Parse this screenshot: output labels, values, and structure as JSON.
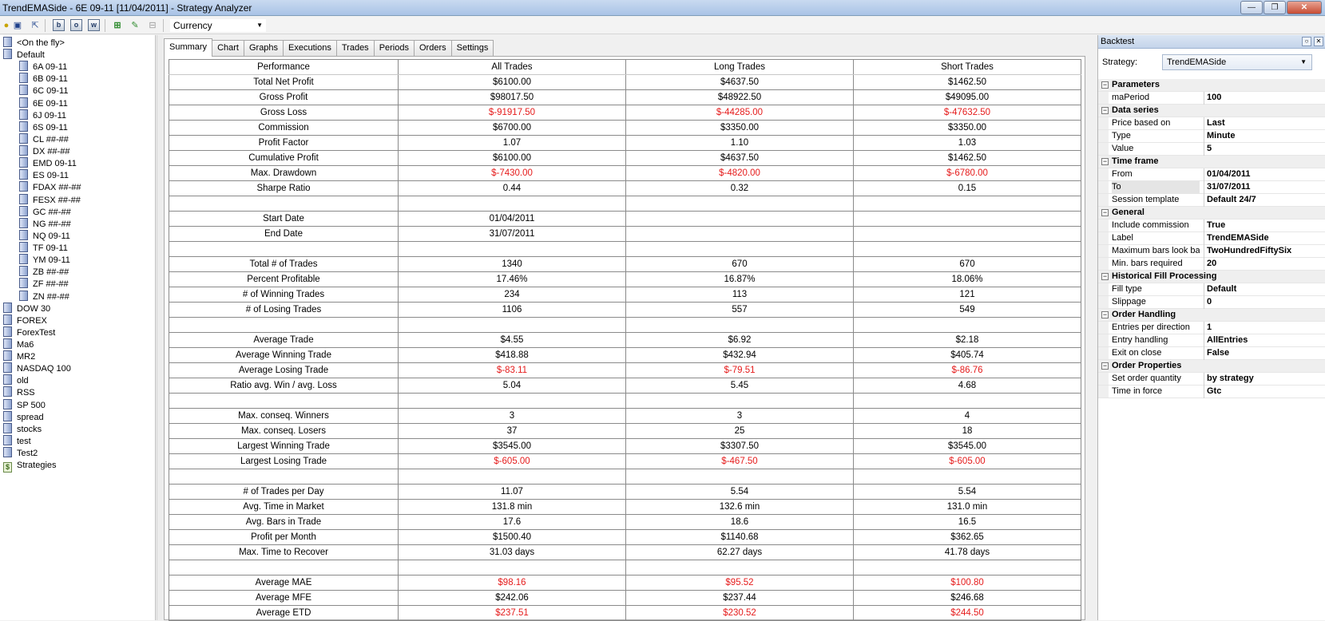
{
  "window": {
    "title": "TrendEMASide - 6E 09-11 [11/04/2011] - Strategy Analyzer"
  },
  "toolbar": {
    "btn_b": "b",
    "btn_o": "o",
    "btn_w": "w",
    "currency_selected": "Currency"
  },
  "tree": [
    {
      "label": "<On the fly>",
      "level": 0,
      "icon": "instrument-list-icon"
    },
    {
      "label": "Default",
      "level": 0,
      "icon": "instrument-list-icon"
    },
    {
      "label": "6A 09-11",
      "level": 1,
      "icon": "instrument-icon"
    },
    {
      "label": "6B 09-11",
      "level": 1,
      "icon": "instrument-icon"
    },
    {
      "label": "6C 09-11",
      "level": 1,
      "icon": "instrument-icon"
    },
    {
      "label": "6E 09-11",
      "level": 1,
      "icon": "instrument-icon"
    },
    {
      "label": "6J 09-11",
      "level": 1,
      "icon": "instrument-icon"
    },
    {
      "label": "6S 09-11",
      "level": 1,
      "icon": "instrument-icon"
    },
    {
      "label": "CL ##-##",
      "level": 1,
      "icon": "instrument-icon"
    },
    {
      "label": "DX ##-##",
      "level": 1,
      "icon": "instrument-icon"
    },
    {
      "label": "EMD 09-11",
      "level": 1,
      "icon": "instrument-icon"
    },
    {
      "label": "ES 09-11",
      "level": 1,
      "icon": "instrument-icon"
    },
    {
      "label": "FDAX ##-##",
      "level": 1,
      "icon": "instrument-icon"
    },
    {
      "label": "FESX ##-##",
      "level": 1,
      "icon": "instrument-icon"
    },
    {
      "label": "GC ##-##",
      "level": 1,
      "icon": "instrument-icon"
    },
    {
      "label": "NG ##-##",
      "level": 1,
      "icon": "instrument-icon"
    },
    {
      "label": "NQ 09-11",
      "level": 1,
      "icon": "instrument-icon"
    },
    {
      "label": "TF 09-11",
      "level": 1,
      "icon": "instrument-icon"
    },
    {
      "label": "YM 09-11",
      "level": 1,
      "icon": "instrument-icon"
    },
    {
      "label": "ZB ##-##",
      "level": 1,
      "icon": "instrument-icon"
    },
    {
      "label": "ZF ##-##",
      "level": 1,
      "icon": "instrument-icon"
    },
    {
      "label": "ZN ##-##",
      "level": 1,
      "icon": "instrument-icon"
    },
    {
      "label": "DOW 30",
      "level": 0,
      "icon": "instrument-list-icon"
    },
    {
      "label": "FOREX",
      "level": 0,
      "icon": "instrument-list-icon"
    },
    {
      "label": "ForexTest",
      "level": 0,
      "icon": "instrument-list-icon"
    },
    {
      "label": "Ma6",
      "level": 0,
      "icon": "instrument-list-icon"
    },
    {
      "label": "MR2",
      "level": 0,
      "icon": "instrument-list-icon"
    },
    {
      "label": "NASDAQ 100",
      "level": 0,
      "icon": "instrument-list-icon"
    },
    {
      "label": "old",
      "level": 0,
      "icon": "instrument-list-icon"
    },
    {
      "label": "RSS",
      "level": 0,
      "icon": "instrument-list-icon"
    },
    {
      "label": "SP 500",
      "level": 0,
      "icon": "instrument-list-icon"
    },
    {
      "label": "spread",
      "level": 0,
      "icon": "instrument-list-icon"
    },
    {
      "label": "stocks",
      "level": 0,
      "icon": "instrument-list-icon"
    },
    {
      "label": "test",
      "level": 0,
      "icon": "instrument-list-icon"
    },
    {
      "label": "Test2",
      "level": 0,
      "icon": "instrument-list-icon"
    },
    {
      "label": "Strategies",
      "level": 0,
      "icon": "strategies-icon"
    }
  ],
  "tabs": [
    "Summary",
    "Chart",
    "Graphs",
    "Executions",
    "Trades",
    "Periods",
    "Orders",
    "Settings"
  ],
  "summary": {
    "headers": [
      "Performance",
      "All Trades",
      "Long Trades",
      "Short Trades"
    ],
    "rows": [
      [
        "Total Net Profit",
        "$6100.00",
        "$4637.50",
        "$1462.50"
      ],
      [
        "Gross Profit",
        "$98017.50",
        "$48922.50",
        "$49095.00"
      ],
      [
        "Gross Loss",
        "$-91917.50",
        "$-44285.00",
        "$-47632.50"
      ],
      [
        "Commission",
        "$6700.00",
        "$3350.00",
        "$3350.00"
      ],
      [
        "Profit Factor",
        "1.07",
        "1.10",
        "1.03"
      ],
      [
        "Cumulative Profit",
        "$6100.00",
        "$4637.50",
        "$1462.50"
      ],
      [
        "Max. Drawdown",
        "$-7430.00",
        "$-4820.00",
        "$-6780.00"
      ],
      [
        "Sharpe Ratio",
        "0.44",
        "0.32",
        "0.15"
      ],
      [
        "",
        "",
        "",
        ""
      ],
      [
        "Start Date",
        "01/04/2011",
        "",
        ""
      ],
      [
        "End Date",
        "31/07/2011",
        "",
        ""
      ],
      [
        "",
        "",
        "",
        ""
      ],
      [
        "Total # of Trades",
        "1340",
        "670",
        "670"
      ],
      [
        "Percent Profitable",
        "17.46%",
        "16.87%",
        "18.06%"
      ],
      [
        "# of Winning Trades",
        "234",
        "113",
        "121"
      ],
      [
        "# of Losing Trades",
        "1106",
        "557",
        "549"
      ],
      [
        "",
        "",
        "",
        ""
      ],
      [
        "Average Trade",
        "$4.55",
        "$6.92",
        "$2.18"
      ],
      [
        "Average Winning Trade",
        "$418.88",
        "$432.94",
        "$405.74"
      ],
      [
        "Average Losing Trade",
        "$-83.11",
        "$-79.51",
        "$-86.76"
      ],
      [
        "Ratio avg. Win / avg. Loss",
        "5.04",
        "5.45",
        "4.68"
      ],
      [
        "",
        "",
        "",
        ""
      ],
      [
        "Max. conseq. Winners",
        "3",
        "3",
        "4"
      ],
      [
        "Max. conseq. Losers",
        "37",
        "25",
        "18"
      ],
      [
        "Largest Winning Trade",
        "$3545.00",
        "$3307.50",
        "$3545.00"
      ],
      [
        "Largest Losing Trade",
        "$-605.00",
        "$-467.50",
        "$-605.00"
      ],
      [
        "",
        "",
        "",
        ""
      ],
      [
        "# of Trades per Day",
        "11.07",
        "5.54",
        "5.54"
      ],
      [
        "Avg. Time in Market",
        "131.8 min",
        "132.6 min",
        "131.0 min"
      ],
      [
        "Avg. Bars in Trade",
        "17.6",
        "18.6",
        "16.5"
      ],
      [
        "Profit per Month",
        "$1500.40",
        "$1140.68",
        "$362.65"
      ],
      [
        "Max. Time to Recover",
        "31.03 days",
        "62.27 days",
        "41.78 days"
      ],
      [
        "",
        "",
        "",
        ""
      ],
      [
        "Average MAE",
        "$98.16",
        "$95.52",
        "$100.80"
      ],
      [
        "Average MFE",
        "$242.06",
        "$237.44",
        "$246.68"
      ],
      [
        "Average ETD",
        "$237.51",
        "$230.52",
        "$244.50"
      ]
    ],
    "negative_color": "#e51b1b",
    "red_rows": [
      2,
      6,
      19,
      25,
      33,
      35
    ]
  },
  "backtest": {
    "header": "Backtest",
    "strategy_label": "Strategy:",
    "strategy_value": "TrendEMASide",
    "categories": [
      {
        "name": "Parameters",
        "props": [
          [
            "maPeriod",
            "100"
          ]
        ]
      },
      {
        "name": "Data series",
        "props": [
          [
            "Price based on",
            "Last"
          ],
          [
            "Type",
            "Minute"
          ],
          [
            "Value",
            "5"
          ]
        ]
      },
      {
        "name": "Time frame",
        "props": [
          [
            "From",
            "01/04/2011"
          ],
          [
            "To",
            "31/07/2011"
          ],
          [
            "Session template",
            "Default 24/7"
          ]
        ]
      },
      {
        "name": "General",
        "props": [
          [
            "Include commission",
            "True"
          ],
          [
            "Label",
            "TrendEMASide"
          ],
          [
            "Maximum bars look back",
            "TwoHundredFiftySix"
          ],
          [
            "Min. bars required",
            "20"
          ]
        ]
      },
      {
        "name": "Historical Fill Processing",
        "props": [
          [
            "Fill type",
            "Default"
          ],
          [
            "Slippage",
            "0"
          ]
        ]
      },
      {
        "name": "Order Handling",
        "props": [
          [
            "Entries per direction",
            "1"
          ],
          [
            "Entry handling",
            "AllEntries"
          ],
          [
            "Exit on close",
            "False"
          ]
        ]
      },
      {
        "name": "Order Properties",
        "props": [
          [
            "Set order quantity",
            "by strategy"
          ],
          [
            "Time in force",
            "Gtc"
          ]
        ]
      }
    ]
  }
}
